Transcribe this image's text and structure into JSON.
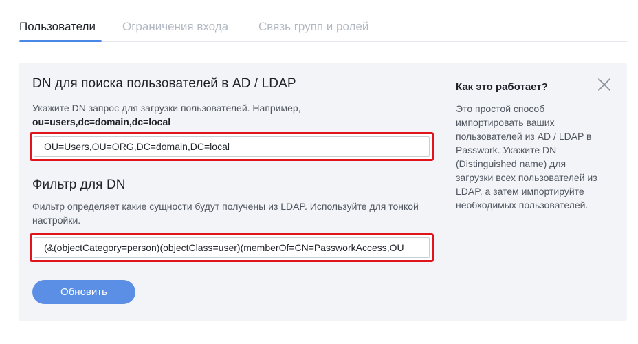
{
  "tabs": [
    {
      "label": "Пользователи",
      "active": true
    },
    {
      "label": "Ограничения входа",
      "active": false
    },
    {
      "label": "Связь групп и ролей",
      "active": false
    }
  ],
  "dn_section": {
    "title": "DN для поиска пользователей в AD / LDAP",
    "description": "Укажите DN запрос для загрузки пользователей. Например,",
    "example": "ou=users,dc=domain,dc=local",
    "value": "OU=Users,OU=ORG,DC=domain,DC=local"
  },
  "filter_section": {
    "title": "Фильтр для DN",
    "description": "Фильтр определяет какие сущности будут получены из LDAP. Используйте для тонкой настройки.",
    "value": "(&(objectCategory=person)(objectClass=user)(memberOf=CN=PassworkAccess,OU"
  },
  "update_button": {
    "label": "Обновить"
  },
  "help": {
    "title": "Как это работает?",
    "text": "Это простой способ импортировать ваших пользователей из AD / LDAP в Passwork. Укажите DN (Distinguished name) для загрузки всех пользователей из LDAP, а затем импортируйте необходимых пользователей."
  },
  "icons": {
    "close": "close-icon"
  },
  "colors": {
    "accent": "#4a88e8",
    "button": "#5b8fe6",
    "highlight": "#e0141c",
    "panel": "#f2f4f7"
  }
}
